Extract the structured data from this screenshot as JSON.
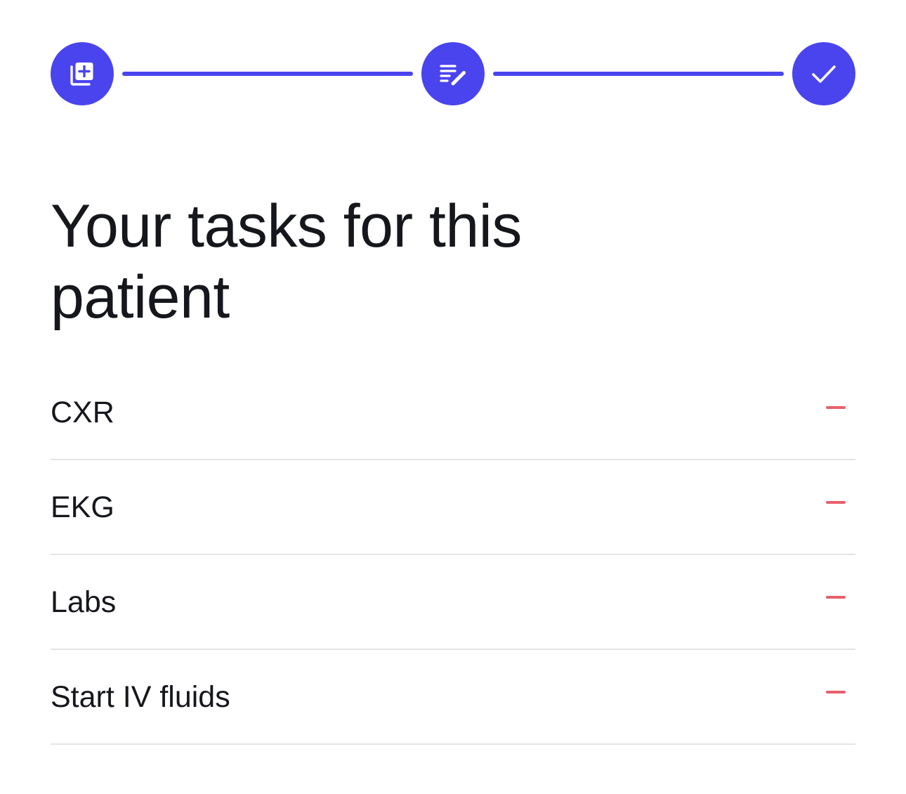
{
  "colors": {
    "accent": "#4a44ee",
    "danger": "#e7606b",
    "divider": "#e3e4e7",
    "text": "#15171c"
  },
  "stepper": {
    "steps": [
      {
        "icon": "add-document-icon",
        "state": "complete"
      },
      {
        "icon": "edit-notes-icon",
        "state": "complete"
      },
      {
        "icon": "checkmark-icon",
        "state": "current"
      }
    ]
  },
  "title": "Your tasks for this patient",
  "tasks": [
    {
      "label": "CXR",
      "action_icon": "minus-icon"
    },
    {
      "label": "EKG",
      "action_icon": "minus-icon"
    },
    {
      "label": "Labs",
      "action_icon": "minus-icon"
    },
    {
      "label": "Start IV fluids",
      "action_icon": "minus-icon"
    }
  ]
}
